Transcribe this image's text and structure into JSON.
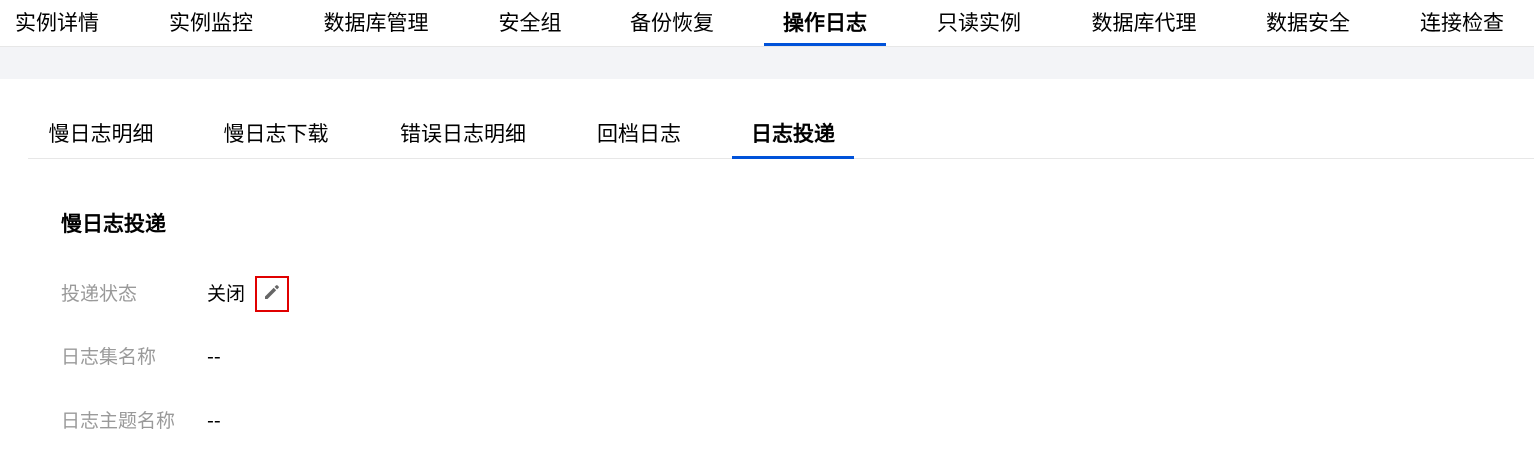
{
  "top_tabs": [
    {
      "label": "实例详情"
    },
    {
      "label": "实例监控"
    },
    {
      "label": "数据库管理"
    },
    {
      "label": "安全组"
    },
    {
      "label": "备份恢复"
    },
    {
      "label": "操作日志"
    },
    {
      "label": "只读实例"
    },
    {
      "label": "数据库代理"
    },
    {
      "label": "数据安全"
    },
    {
      "label": "连接检查"
    }
  ],
  "top_tabs_active": "操作日志",
  "sub_tabs": [
    {
      "label": "慢日志明细"
    },
    {
      "label": "慢日志下载"
    },
    {
      "label": "错误日志明细"
    },
    {
      "label": "回档日志"
    },
    {
      "label": "日志投递"
    }
  ],
  "sub_tabs_active": "日志投递",
  "section": {
    "title": "慢日志投递",
    "fields": [
      {
        "label": "投递状态",
        "value": "关闭"
      },
      {
        "label": "日志集名称",
        "value": "--"
      },
      {
        "label": "日志主题名称",
        "value": "--"
      }
    ]
  },
  "icons": {
    "edit": "pencil-icon"
  },
  "colors": {
    "accent": "#0052d9",
    "highlight_border": "#e00000",
    "label_gray": "#9a9a9a",
    "band_gray": "#f3f4f7"
  }
}
